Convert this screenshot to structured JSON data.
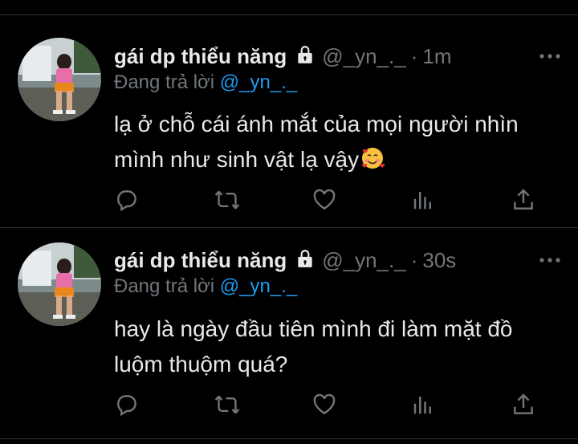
{
  "colors": {
    "background": "#000000",
    "text": "#e7e9ea",
    "muted": "#71767b",
    "accent": "#1d9bf0",
    "divider": "#2f3336"
  },
  "tweets": [
    {
      "display_name": "gái dp thiểu năng",
      "handle": "@_yn_._",
      "separator": "·",
      "time": "1m",
      "reply_prefix": "Đang trả lời",
      "reply_to": "@_yn_._",
      "text_line1": "lạ ở chỗ cái ánh mắt của mọi người nhìn",
      "text_line2": "mình như sinh vật lạ vậy",
      "emoji": "smiling-face-with-hearts"
    },
    {
      "display_name": "gái dp thiểu năng",
      "handle": "@_yn_._",
      "separator": "·",
      "time": "30s",
      "reply_prefix": "Đang trả lời",
      "reply_to": "@_yn_._",
      "text_line1": "hay là ngày đầu tiên mình đi làm mặt đồ",
      "text_line2": "luộm thuộm quá?"
    }
  ],
  "icons": [
    "lock-icon",
    "more-icon",
    "reply-icon",
    "retweet-icon",
    "like-icon",
    "analytics-icon",
    "share-icon"
  ]
}
